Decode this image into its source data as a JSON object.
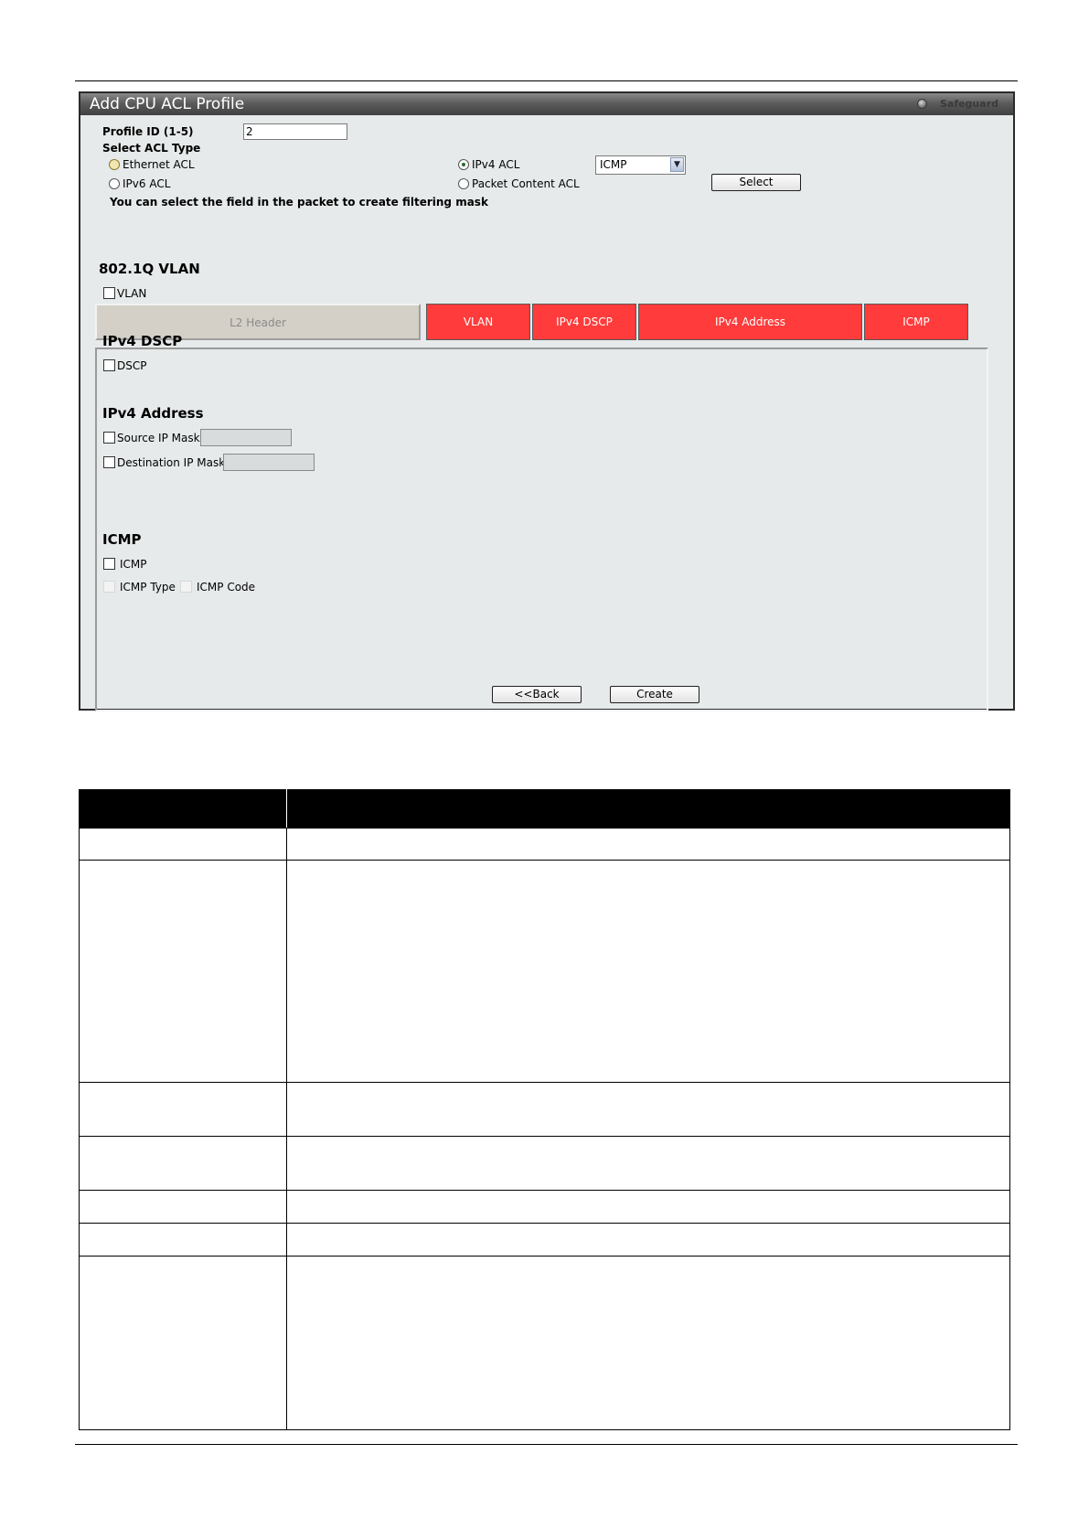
{
  "window": {
    "title": "Add CPU ACL Profile",
    "safeguard": "Safeguard"
  },
  "form": {
    "profile_id_label": "Profile ID (1-5)",
    "profile_id_value": "2",
    "select_acl_type_label": "Select ACL Type",
    "acl_types": [
      {
        "label": "Ethernet ACL",
        "selected": false
      },
      {
        "label": "IPv4 ACL",
        "selected": true
      },
      {
        "label": "IPv6 ACL",
        "selected": false
      },
      {
        "label": "Packet Content ACL",
        "selected": false
      }
    ],
    "protocol_select_value": "ICMP",
    "select_button": "Select",
    "hint": "You can select the field in the packet to create filtering mask"
  },
  "tabs": [
    {
      "label": "L2 Header",
      "enabled": false
    },
    {
      "label": "VLAN",
      "enabled": true
    },
    {
      "label": "IPv4 DSCP",
      "enabled": true
    },
    {
      "label": "IPv4 Address",
      "enabled": true
    },
    {
      "label": "ICMP",
      "enabled": true
    }
  ],
  "sections": {
    "vlan": {
      "title": "802.1Q VLAN",
      "checkbox": "VLAN"
    },
    "dscp": {
      "title": "IPv4 DSCP",
      "checkbox": "DSCP"
    },
    "address": {
      "title": "IPv4 Address",
      "source": "Source IP Mask",
      "destination": "Destination IP Mask"
    },
    "icmp": {
      "title": "ICMP",
      "checkbox": "ICMP",
      "type": "ICMP Type",
      "code": "ICMP Code"
    }
  },
  "buttons": {
    "back": "<<Back",
    "create": "Create"
  },
  "colors": {
    "tab_active": "#ff3b3b",
    "panel_bg": "#e6eaea",
    "title_bar": "#5c5c5c"
  }
}
